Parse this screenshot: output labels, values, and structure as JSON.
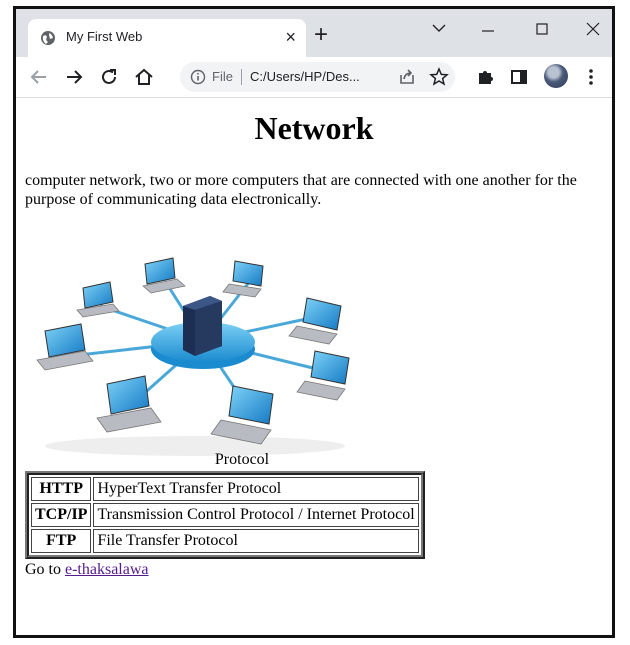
{
  "browser": {
    "tab_title": "My First Web",
    "tab_close": "×",
    "new_tab": "+",
    "address": {
      "scheme_label": "File",
      "url": "C:/Users/HP/Des..."
    }
  },
  "page": {
    "heading": "Network",
    "paragraph": "computer network, two or more computers that are connected with one another for the purpose of communicating data electronically.",
    "image_icon": "network-diagram-image",
    "caption": "Protocol",
    "protocols": [
      {
        "abbr": "HTTP",
        "name": "HyperText Transfer Protocol"
      },
      {
        "abbr": "TCP/IP",
        "name": "Transmission Control Protocol / Internet Protocol"
      },
      {
        "abbr": "FTP",
        "name": "File Transfer Protocol"
      }
    ],
    "goto_prefix": "Go to",
    "link_text": "e-thaksalawa"
  },
  "colors": {
    "tabbar": "#dee1e6",
    "omnibox": "#f1f3f4",
    "visited_link": "#551a8b",
    "hub": "#3aa7e0",
    "cable": "#4aa8d8"
  }
}
